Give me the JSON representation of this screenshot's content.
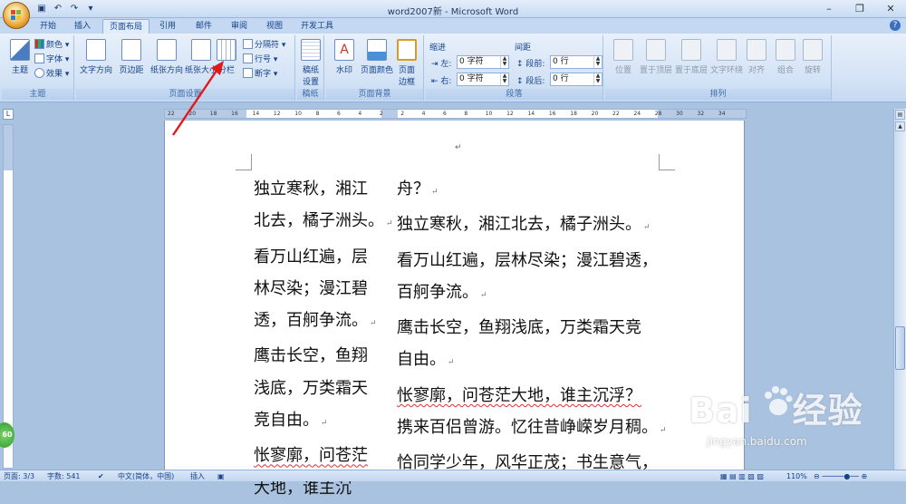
{
  "window": {
    "title": "word2007新 - Microsoft Word"
  },
  "tabs": [
    "开始",
    "插入",
    "页面布局",
    "引用",
    "邮件",
    "审阅",
    "视图",
    "开发工具"
  ],
  "active_tab": "页面布局",
  "ribbon": {
    "themes": {
      "big": "主题",
      "colors": "颜色",
      "fonts": "字体",
      "effects": "效果",
      "group": "主题"
    },
    "page_setup": {
      "text_dir": "文字方向",
      "margins": "页边距",
      "orientation": "纸张方向",
      "size": "纸张大小",
      "columns": "分栏",
      "breaks": "分隔符",
      "line_numbers": "行号",
      "hyphenation": "断字",
      "group": "页面设置"
    },
    "draft": {
      "setup": "稿纸",
      "setup2": "设置",
      "group": "稿纸"
    },
    "background": {
      "watermark": "水印",
      "page_color": "页面颜色",
      "borders1": "页面",
      "borders2": "边框",
      "group": "页面背景"
    },
    "paragraph": {
      "indent": "缩进",
      "left": "左:",
      "left_val": "0 字符",
      "right": "右:",
      "right_val": "0 字符",
      "spacing": "间距",
      "before": "段前:",
      "before_val": "0 行",
      "after": "段后:",
      "after_val": "0 行",
      "group": "段落"
    },
    "arrange": {
      "position": "位置",
      "front": "置于顶层",
      "back": "置于底层",
      "wrap": "文字环绕",
      "align": "对齐",
      "group_btn": "组合",
      "rotate": "旋转",
      "group": "排列"
    }
  },
  "ruler_numbers": [
    "22",
    "20",
    "18",
    "16",
    "14",
    "12",
    "10",
    "8",
    "6",
    "4",
    "2",
    "2",
    "4",
    "6",
    "8",
    "10",
    "12",
    "14",
    "16",
    "18",
    "20",
    "22",
    "24",
    "28",
    "30",
    "32",
    "34"
  ],
  "document": {
    "header_mark": "↵",
    "left_column": [
      "独立寒秋，湘江",
      "北去，橘子洲头。",
      "看万山红遍，层",
      "林尽染；漫江碧",
      "透，百舸争流。",
      "鹰击长空，鱼翔",
      "浅底，万类霜天",
      "竞自由。",
      "怅寥廓，问苍茫",
      "大地，谁主沉"
    ],
    "left_marks": [
      "",
      "↵",
      "",
      "",
      "↵",
      "",
      "",
      "↵",
      "",
      ""
    ],
    "right_column": [
      "舟？",
      "",
      "独立寒秋，湘江北去，橘子洲头。",
      "看万山红遍，层林尽染；漫江碧透，",
      "百舸争流。",
      "鹰击长空，鱼翔浅底，万类霜天竞",
      "自由。",
      "怅寥廓，问苍茫大地，谁主沉浮？",
      "携来百侣曾游。忆往昔峥嵘岁月稠。",
      "恰同学少年，风华正茂；书生意气，"
    ],
    "right_marks": [
      "↵",
      "",
      "↵",
      "",
      "↵",
      "",
      "↵",
      "",
      "↵",
      ""
    ]
  },
  "status": {
    "page": "页面: 3/3",
    "words": "字数: 541",
    "language": "中文(简体，中国)",
    "insert": "插入",
    "zoom": "110%"
  },
  "watermark": {
    "brand": "Bai",
    "brand2": "经验",
    "sub": "jingyan.baidu.com"
  },
  "badge": "60"
}
